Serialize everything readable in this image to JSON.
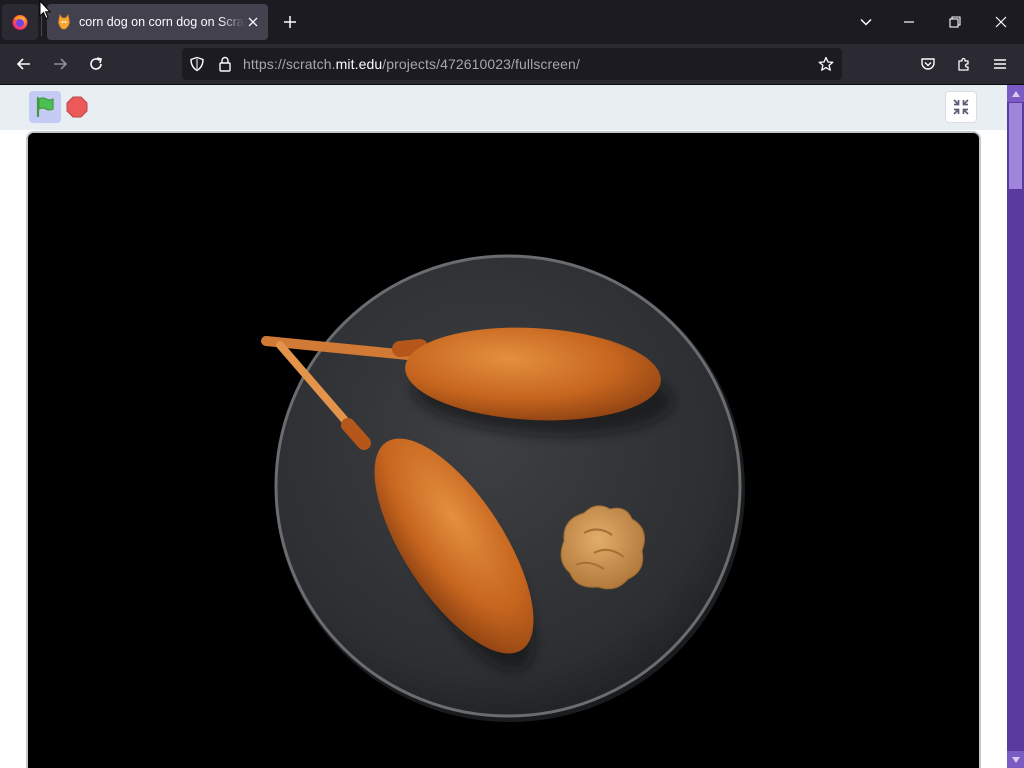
{
  "browser": {
    "tab": {
      "title": "corn dog on corn dog on Scratch",
      "favicon": "scratch-cat-favicon"
    },
    "url": {
      "prefix": "https://scratch.",
      "host": "mit.edu",
      "path": "/projects/472610023/fullscreen/"
    },
    "icons": {
      "firefox_menu": "firefox-icon",
      "new_tab": "plus-icon",
      "tab_list": "chevron-down-icon",
      "minimize": "minimize-icon",
      "restore": "restore-icon",
      "close": "close-icon",
      "back": "arrow-left-icon",
      "forward": "arrow-right-icon",
      "reload": "reload-icon",
      "tracking_protection": "shield-icon",
      "site_security": "lock-icon",
      "bookmark": "star-icon",
      "pocket": "pocket-icon",
      "extensions": "puzzle-icon",
      "app_menu": "hamburger-icon"
    }
  },
  "scratch": {
    "controls": {
      "green_flag": "green-flag-icon",
      "stop": "stop-sign-icon",
      "exit_fullscreen": "unfullscreen-icon"
    },
    "stage": {
      "image": "two corn dogs on a dark plate with mustard"
    }
  },
  "colors": {
    "browser_bg": "#1c1b22",
    "toolbar_bg": "#2b2a33",
    "active_tab_bg": "#42414d",
    "scratch_header_bg": "#e9eef2",
    "green_flag_active_bg": "#c3caf3",
    "scrollbar_track": "#5b3aa0"
  }
}
